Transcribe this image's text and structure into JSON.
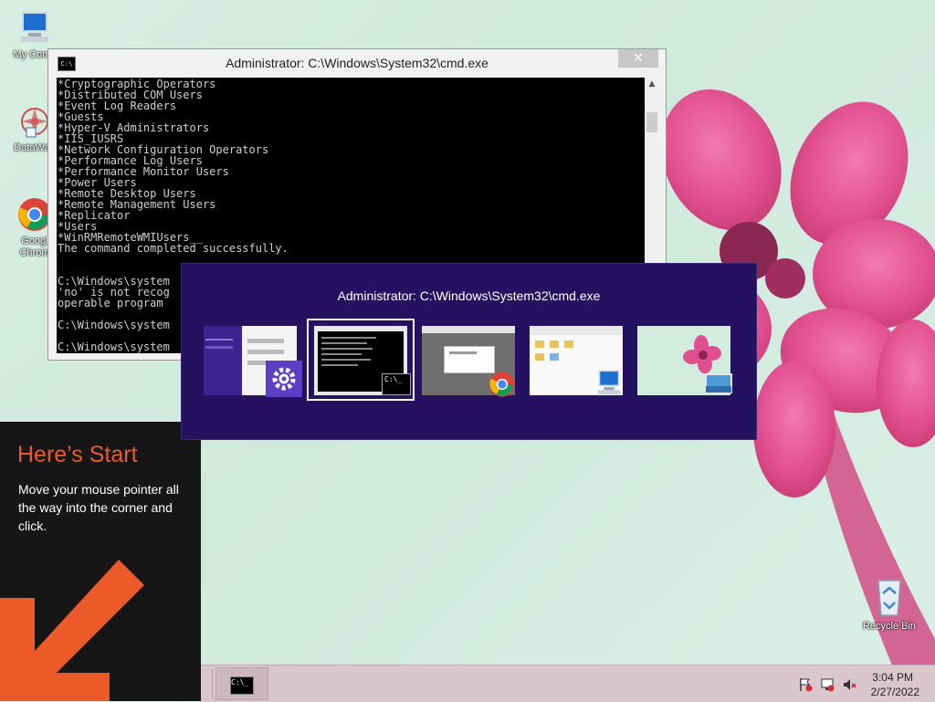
{
  "desktop": {
    "icons": [
      {
        "label": "My Comp"
      },
      {
        "label": "DataWag"
      },
      {
        "label": "Googl Chrom"
      },
      {
        "label": "Recycle Bin"
      }
    ]
  },
  "cmd_window": {
    "title": "Administrator: C:\\Windows\\System32\\cmd.exe",
    "close_label": "✕",
    "console_text": "*Cryptographic Operators\n*Distributed COM Users\n*Event Log Readers\n*Guests\n*Hyper-V Administrators\n*IIS_IUSRS\n*Network Configuration Operators\n*Performance Log Users\n*Performance Monitor Users\n*Power Users\n*Remote Desktop Users\n*Remote Management Users\n*Replicator\n*Users\n*WinRMRemoteWMIUsers__\nThe command completed successfully.\n\n\nC:\\Windows\\system\n'no' is not recog\noperable program\n\nC:\\Windows\\system\n\nC:\\Windows\\system"
  },
  "start_tip": {
    "title": "Here’s Start",
    "body": "Move your mouse pointer all the way into the corner and click."
  },
  "switcher": {
    "title": "Administrator: C:\\Windows\\System32\\cmd.exe",
    "thumbnails": [
      {
        "name": "Settings",
        "icon": "gear-icon"
      },
      {
        "name": "cmd.exe",
        "icon": "cmd-icon",
        "selected": true
      },
      {
        "name": "Google Chrome",
        "icon": "chrome-icon"
      },
      {
        "name": "File Explorer",
        "icon": "computer-icon"
      },
      {
        "name": "Desktop",
        "icon": "desktop-icon"
      }
    ]
  },
  "taskbar": {
    "cmd_glyph": "C:\\_",
    "clock_time": "3:04 PM",
    "clock_date": "2/27/2022"
  },
  "colors": {
    "switcher_bg": "#24115f",
    "tip_accent": "#ec5a2a",
    "taskbar_bg": "#dac7ce"
  }
}
